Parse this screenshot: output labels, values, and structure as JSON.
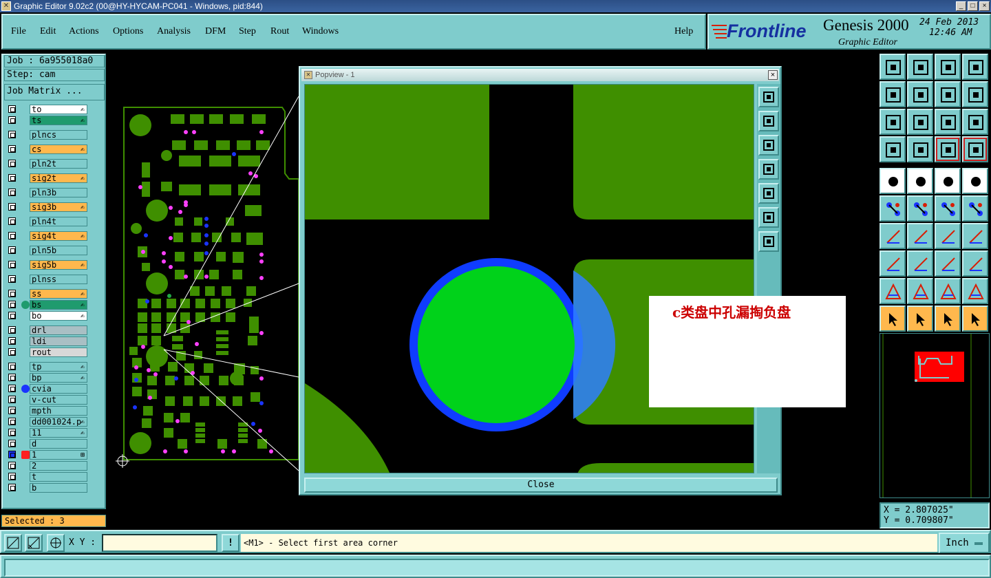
{
  "window": {
    "title": "Graphic Editor 9.02c2 (00@HY-HYCAM-PC041 - Windows, pid:844)",
    "min_label": "_",
    "max_label": "□",
    "close_label": "×"
  },
  "menu": {
    "items": [
      "File",
      "Edit",
      "Actions",
      "Options",
      "Analysis",
      "DFM",
      "Step",
      "Rout",
      "Windows"
    ],
    "help": "Help"
  },
  "brand": {
    "logo": "Frontline",
    "product": "Genesis 2000",
    "subtitle": "Graphic Editor",
    "date": "24 Feb 2013",
    "time": "12:46 AM"
  },
  "job": {
    "job_label": "Job : 6a955018a0",
    "step_label": "Step: cam",
    "matrix_button": "Job Matrix ..."
  },
  "layers": [
    {
      "name": "to",
      "color": "#ffffff",
      "mark": "✍"
    },
    {
      "name": "ts",
      "color": "#1f9b6e",
      "mark": "✍"
    },
    {
      "name": "plncs",
      "color": "#7fcccc",
      "mark": ""
    },
    {
      "name": "cs",
      "color": "#ffb84d",
      "mark": "✍"
    },
    {
      "name": "pln2t",
      "color": "#7fcccc",
      "mark": ""
    },
    {
      "name": "sig2t",
      "color": "#ffb84d",
      "mark": "✍"
    },
    {
      "name": "pln3b",
      "color": "#7fcccc",
      "mark": ""
    },
    {
      "name": "sig3b",
      "color": "#ffb84d",
      "mark": "✍"
    },
    {
      "name": "pln4t",
      "color": "#7fcccc",
      "mark": ""
    },
    {
      "name": "sig4t",
      "color": "#ffb84d",
      "mark": "✍"
    },
    {
      "name": "pln5b",
      "color": "#7fcccc",
      "mark": ""
    },
    {
      "name": "sig5b",
      "color": "#ffb84d",
      "mark": "✍"
    },
    {
      "name": "plnss",
      "color": "#7fcccc",
      "mark": ""
    },
    {
      "name": "ss",
      "color": "#ffb84d",
      "mark": "✍"
    },
    {
      "name": "bs",
      "color": "#1f9b6e",
      "mark": "✍"
    },
    {
      "name": "bo",
      "color": "#ffffff",
      "mark": "✍"
    },
    {
      "name": "drl",
      "color": "#a9bfc4",
      "mark": ""
    },
    {
      "name": "ldi",
      "color": "#a9bfc4",
      "mark": ""
    },
    {
      "name": "rout",
      "color": "#d8d8d8",
      "mark": ""
    },
    {
      "name": "tp",
      "color": "#7fcccc",
      "mark": "✍"
    },
    {
      "name": "bp",
      "color": "#7fcccc",
      "mark": "✍"
    },
    {
      "name": "cvia",
      "color": "#7fcccc",
      "mark": ""
    },
    {
      "name": "v-cut",
      "color": "#7fcccc",
      "mark": ""
    },
    {
      "name": "mpth",
      "color": "#7fcccc",
      "mark": ""
    },
    {
      "name": "dd001024.p",
      "color": "#7fcccc",
      "mark": "✍"
    },
    {
      "name": "11",
      "color": "#7fcccc",
      "mark": "✍"
    },
    {
      "name": "d",
      "color": "#7fcccc",
      "mark": ""
    },
    {
      "name": "1",
      "color": "#7fcccc",
      "mark": "⊞"
    },
    {
      "name": "2",
      "color": "#7fcccc",
      "mark": ""
    },
    {
      "name": "t",
      "color": "#7fcccc",
      "mark": ""
    },
    {
      "name": "b",
      "color": "#7fcccc",
      "mark": ""
    }
  ],
  "selected": "Selected : 3",
  "popview": {
    "title": "Popview - 1",
    "close_button": "Close"
  },
  "note": "c类盘中孔漏掏负盘",
  "coords": {
    "x": "X = 2.807025\"",
    "y": "Y = 0.709807\""
  },
  "status": {
    "xy_label": "X Y :",
    "xy_value": "",
    "bang": "!",
    "prompt": "<M1> - Select first area corner",
    "units": "Inch"
  },
  "colors": {
    "panel": "#7fcccc",
    "copper": "#3f8f00",
    "pad": "#00d21a",
    "ring": "#0f3cff",
    "via_pink": "#ff40ff",
    "via_blue": "#1a34ff"
  }
}
